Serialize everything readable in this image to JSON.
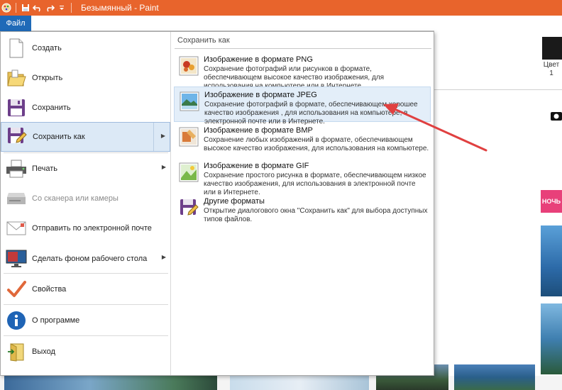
{
  "window": {
    "title": "Безымянный - Paint"
  },
  "ribbon": {
    "file_tab": "Файл"
  },
  "background": {
    "color_label": "Цвет 1",
    "pink_label": "НОЧЬ"
  },
  "file_menu": {
    "items": [
      {
        "label": "Создать",
        "icon": "new-document-icon"
      },
      {
        "label": "Открыть",
        "icon": "open-folder-icon"
      },
      {
        "label": "Сохранить",
        "icon": "floppy-disk-icon"
      },
      {
        "label": "Сохранить как",
        "icon": "save-as-icon"
      },
      {
        "label": "Печать",
        "icon": "printer-icon"
      },
      {
        "label": "Со сканера или камеры",
        "icon": "scanner-icon"
      },
      {
        "label": "Отправить по электронной почте",
        "icon": "email-icon"
      },
      {
        "label": "Сделать фоном рабочего стола",
        "icon": "desktop-background-icon"
      },
      {
        "label": "Свойства",
        "icon": "properties-check-icon"
      },
      {
        "label": "О программе",
        "icon": "info-icon"
      },
      {
        "label": "Выход",
        "icon": "exit-icon"
      }
    ]
  },
  "save_as_submenu": {
    "header": "Сохранить как",
    "items": [
      {
        "title": "Изображение в формате PNG",
        "description": "Сохранение фотографий или рисунков в формате, обеспечивающем высокое качество изображения, для использования на компьютере или в Интернете.",
        "icon": "png-image-icon"
      },
      {
        "title": "Изображение в формате JPEG",
        "description": "Сохранение фотографий в формате, обеспечивающем хорошее качество изображения , для использования на компьютере, в электронной почте или в Интернете.",
        "icon": "jpeg-image-icon"
      },
      {
        "title": "Изображение в формате BMP",
        "description": "Сохранение любых изображений в формате, обеспечивающем высокое качество изображения, для использования на компьютере.",
        "icon": "bmp-image-icon"
      },
      {
        "title": "Изображение в формате GIF",
        "description": "Сохранение простого рисунка в формате, обеспечивающем низкое качество изображения, для использования в электронной почте или в Интернете.",
        "icon": "gif-image-icon"
      },
      {
        "title": "Другие форматы",
        "description": "Открытие диалогового окна \"Сохранить как\" для выбора доступных типов файлов.",
        "icon": "other-formats-icon"
      }
    ]
  },
  "colors": {
    "titlebar": "#e8642c",
    "file_tab": "#1f6ab8",
    "active_item": "#dce9f6",
    "annotation_arrow": "#e04040"
  }
}
